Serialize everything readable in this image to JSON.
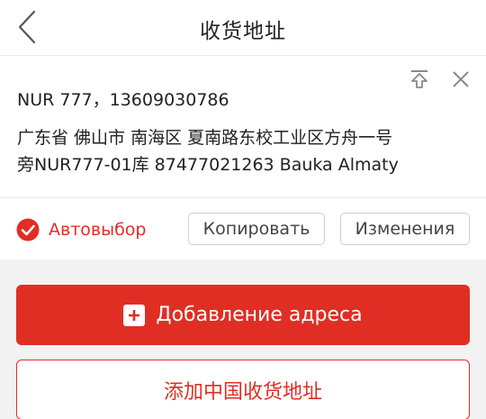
{
  "header": {
    "title": "收货地址",
    "back_icon": "chevron-left-icon"
  },
  "address": {
    "name_phone": "NUR 777，13609030786",
    "line1": "广东省 佛山市 南海区 夏南路东校工业区方舟一号",
    "line2": "旁NUR777-01库 87477021263 Bauka Almaty",
    "icons": [
      "pin-top-icon",
      "close-icon"
    ]
  },
  "options": {
    "auto_label": "Автовыбор",
    "copy_label": "Копировать",
    "edit_label": "Изменения",
    "check_icon": "check-circle-icon"
  },
  "actions": {
    "add_address_label": "Добавление адреса",
    "add_china_label": "添加中国收货地址",
    "plus_icon": "plus-square-icon"
  },
  "colors": {
    "accent": "#e02e24",
    "background_gray": "#f2f2f2",
    "text": "#222222"
  }
}
